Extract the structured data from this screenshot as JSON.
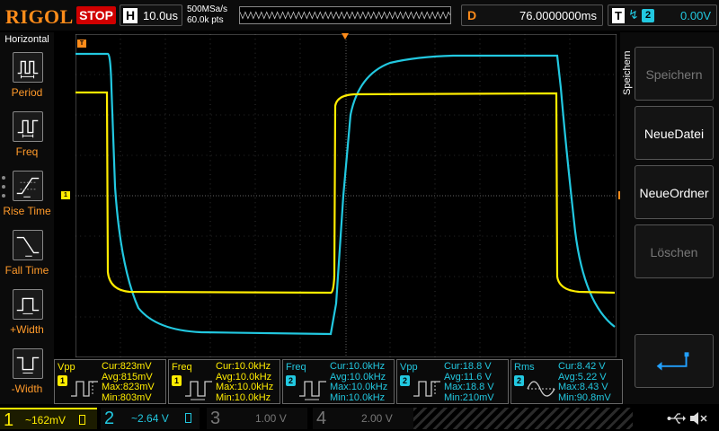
{
  "topbar": {
    "logo": "RIGOL",
    "run_status": "STOP",
    "timebase_letter": "H",
    "timebase": "10.0us",
    "sample_rate": "500MSa/s",
    "memory_depth": "60.0k pts",
    "delay_letter": "D",
    "delay": "76.0000000ms",
    "trigger_letter": "T",
    "trigger_edge": "↯",
    "trigger_source": "2",
    "trigger_level": "0.00V"
  },
  "left_menu": {
    "title": "Horizontal",
    "items": [
      {
        "label": "Period",
        "icon": "period-icon"
      },
      {
        "label": "Freq",
        "icon": "freq-icon"
      },
      {
        "label": "Rise Time",
        "icon": "rise-time-icon"
      },
      {
        "label": "Fall Time",
        "icon": "fall-time-icon"
      },
      {
        "label": "+Width",
        "icon": "positive-width-icon"
      },
      {
        "label": "-Width",
        "icon": "negative-width-icon"
      }
    ]
  },
  "right_menu": {
    "title": "Speichern",
    "softkeys": [
      {
        "label": "Speichern",
        "enabled": false
      },
      {
        "label": "NeueDatei",
        "enabled": true
      },
      {
        "label": "NeueOrdner",
        "enabled": true
      },
      {
        "label": "Löschen",
        "enabled": false
      }
    ],
    "return_icon": "return-arrow-icon"
  },
  "markers": {
    "ch1": "1",
    "trigger_pos": "T"
  },
  "measurements": [
    {
      "name": "Vpp",
      "channel": "1",
      "cur": "Cur:823mV",
      "avg": "Avg:815mV",
      "max": "Max:823mV",
      "min": "Min:803mV",
      "icon": "vpp-icon"
    },
    {
      "name": "Freq",
      "channel": "1",
      "cur": "Cur:10.0kHz",
      "avg": "Avg:10.0kHz",
      "max": "Max:10.0kHz",
      "min": "Min:10.0kHz",
      "icon": "freq-icon"
    },
    {
      "name": "Freq",
      "channel": "2",
      "cur": "Cur:10.0kHz",
      "avg": "Avg:10.0kHz",
      "max": "Max:10.0kHz",
      "min": "Min:10.0kHz",
      "icon": "freq-icon"
    },
    {
      "name": "Vpp",
      "channel": "2",
      "cur": "Cur:18.8 V",
      "avg": "Avg:11.6 V",
      "max": "Max:18.8 V",
      "min": "Min:210mV",
      "icon": "vpp-icon"
    },
    {
      "name": "Rms",
      "channel": "2",
      "cur": "Cur:8.42 V",
      "avg": "Avg:5.22 V",
      "max": "Max:8.43 V",
      "min": "Min:90.8mV",
      "icon": "rms-icon"
    }
  ],
  "channels": [
    {
      "num": "1",
      "scale": "~162mV",
      "color": "#ffec00",
      "active": true
    },
    {
      "num": "2",
      "scale": "~2.64 V",
      "color": "#22c8e0",
      "active": true
    },
    {
      "num": "3",
      "scale": "1.00 V",
      "color": "#b000b0",
      "active": false
    },
    {
      "num": "4",
      "scale": "2.00 V",
      "color": "#2a5cff",
      "active": false
    }
  ],
  "colors": {
    "ch1": "#ffec00",
    "ch2": "#22c8e0",
    "accent": "#ff8c1a",
    "stop": "#d10000"
  }
}
